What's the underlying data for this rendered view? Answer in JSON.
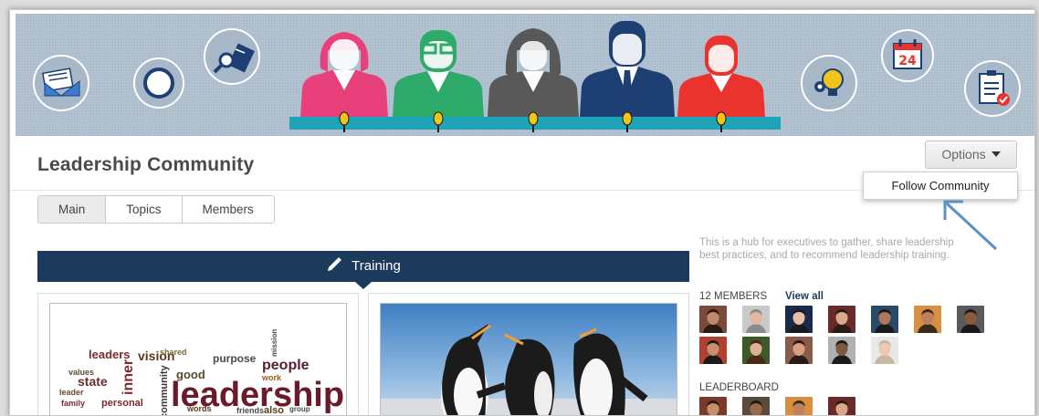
{
  "page": {
    "title": "Leadership Community",
    "options_label": "Options",
    "dropdown": {
      "follow_label": "Follow Community"
    }
  },
  "tabs": [
    {
      "label": "Main",
      "active": true
    },
    {
      "label": "Topics",
      "active": false
    },
    {
      "label": "Members",
      "active": false
    }
  ],
  "feature": {
    "label": "Training",
    "icon": "pencil-icon"
  },
  "cards": [
    {
      "image": "leadership-word-cloud"
    },
    {
      "image": "penguins-photo"
    }
  ],
  "sidebar": {
    "description": "This is a hub for executives to gather, share leadership best practices, and to recommend leadership training.",
    "members_label": "12 MEMBERS",
    "view_all": "View all",
    "leaderboard_label": "LEADERBOARD"
  },
  "banner": {
    "icons": [
      "envelope-icon",
      "compass-icon",
      "magnifier-document-icon",
      "lightbulb-gears-icon",
      "calendar-24-icon",
      "clipboard-checklist-icon"
    ],
    "calendar_day": "24",
    "people_colors": [
      "#e8407a",
      "#2eab6b",
      "#585858",
      "#1e3f74",
      "#e8332e"
    ],
    "desk_color": "#1ea3b8"
  },
  "word_cloud": {
    "big_word": "leadership",
    "words": [
      "leaders",
      "vision",
      "purpose",
      "people",
      "state",
      "inner",
      "good",
      "personal",
      "community",
      "shared",
      "friends",
      "also",
      "work",
      "leader",
      "group",
      "values",
      "family",
      "words",
      "mission"
    ]
  },
  "colors": {
    "navy": "#1c3a5c",
    "accent_arrow": "#5b8fc9"
  }
}
